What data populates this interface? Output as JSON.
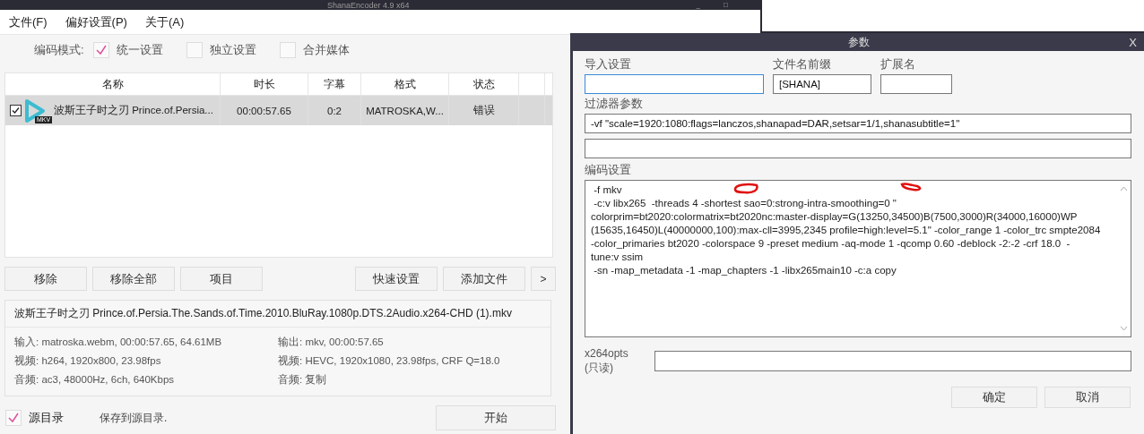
{
  "window": {
    "title": "ShanaEncoder 4.9 x64",
    "controls": [
      "_",
      "□"
    ]
  },
  "menu": [
    "文件(F)",
    "偏好设置(P)",
    "关于(A)"
  ],
  "mode": {
    "label": "编码模式:",
    "options": [
      {
        "label": "统一设置",
        "checked": true
      },
      {
        "label": "独立设置",
        "checked": false
      },
      {
        "label": "合并媒体",
        "checked": false
      }
    ]
  },
  "table": {
    "columns": [
      "名称",
      "时长",
      "字幕",
      "格式",
      "状态"
    ],
    "rows": [
      {
        "checked": true,
        "selected": true,
        "badge": "MKV",
        "name": "波斯王子时之刃 Prince.of.Persia...",
        "duration": "00:00:57.65",
        "subtitles": "0:2",
        "format": "MATROSKA,W...",
        "status": "错误"
      }
    ]
  },
  "buttons": [
    "移除",
    "移除全部",
    "项目",
    "快速设置",
    "添加文件",
    ">"
  ],
  "info": {
    "file": "波斯王子时之刃 Prince.of.Persia.The.Sands.of.Time.2010.BluRay.1080p.DTS.2Audio.x264-CHD (1).mkv",
    "input": [
      "输入: matroska.webm, 00:00:57.65, 64.61MB",
      "视频: h264, 1920x800, 23.98fps",
      "音频: ac3, 48000Hz, 6ch, 640Kbps"
    ],
    "output": [
      "输出: mkv, 00:00:57.65",
      "视频: HEVC, 1920x1080, 23.98fps, CRF Q=18.0",
      "音频: 复制"
    ]
  },
  "footer": {
    "source_dir": {
      "label": "源目录",
      "checked": true
    },
    "note": "保存到源目录.",
    "start": "开始"
  },
  "dialog": {
    "title": "参数",
    "close": "X",
    "import_label": "导入设置",
    "prefix_label": "文件名前缀",
    "prefix": "[SHANA]",
    "ext_label": "扩展名",
    "filter_label": "过滤器参数",
    "filter": "-vf \"scale=1920:1080:flags=lanczos,shanapad=DAR,setsar=1/1,shanasubtitle=1\"",
    "encode_label": "编码设置",
    "encode_lines": [
      " -f mkv",
      " -c:v libx265  -threads 4 -shortest sao=0:strong-intra-smoothing=0 \"",
      "colorprim=bt2020:colormatrix=bt2020nc:master-display=G(13250,34500)B(7500,3000)R(34000,16000)WP",
      "(15635,16450)L(40000000,100):max-cll=3995,2345 profile=high:level=5.1\" -color_range 1 -color_trc smpte2084",
      "-color_primaries bt2020 -colorspace 9 -preset medium -aq-mode 1 -qcomp 0.60 -deblock -2:-2 -crf 18.0  -",
      "tune:v ssim",
      " -sn -map_metadata -1 -map_chapters -1 -libx265main10 -c:a copy"
    ],
    "x264_label": [
      "x264opts",
      "(只读)"
    ],
    "ok": "确定",
    "cancel": "取消"
  }
}
